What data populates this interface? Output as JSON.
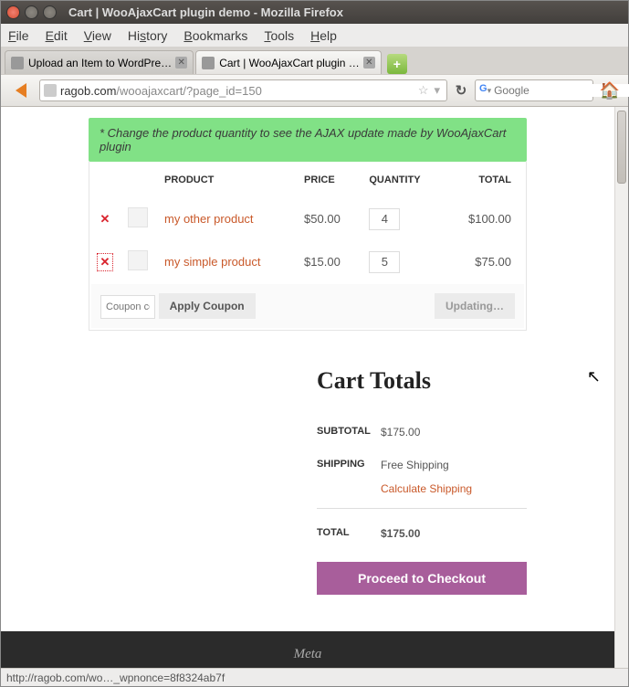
{
  "window": {
    "title": "Cart | WooAjaxCart plugin demo - Mozilla Firefox"
  },
  "menu": {
    "file": "File",
    "edit": "Edit",
    "view": "View",
    "history": "History",
    "bookmarks": "Bookmarks",
    "tools": "Tools",
    "help": "Help"
  },
  "tabs": {
    "tab1": "Upload an Item to WordPre…",
    "tab2": "Cart | WooAjaxCart plugin …"
  },
  "url": {
    "domain": "ragob.com",
    "path": "/wooajaxcart/?page_id=150"
  },
  "search": {
    "placeholder": "Google"
  },
  "notice": "* Change the product quantity to see the AJAX update made by WooAjaxCart plugin",
  "headers": {
    "product": "PRODUCT",
    "price": "PRICE",
    "quantity": "QUANTITY",
    "total": "TOTAL"
  },
  "rows": [
    {
      "name": "my other product",
      "price": "$50.00",
      "qty": "4",
      "total": "$100.00"
    },
    {
      "name": "my simple product",
      "price": "$15.00",
      "qty": "5",
      "total": "$75.00"
    }
  ],
  "coupon": {
    "placeholder": "Coupon code",
    "apply": "Apply Coupon",
    "updating": "Updating…"
  },
  "totals": {
    "title": "Cart Totals",
    "subtotal_label": "SUBTOTAL",
    "subtotal": "$175.00",
    "shipping_label": "SHIPPING",
    "shipping": "Free Shipping",
    "calc": "Calculate Shipping",
    "total_label": "TOTAL",
    "total": "$175.00",
    "checkout": "Proceed to Checkout"
  },
  "footer": {
    "meta": "Meta"
  },
  "status": "http://ragob.com/wo…_wpnonce=8f8324ab7f"
}
